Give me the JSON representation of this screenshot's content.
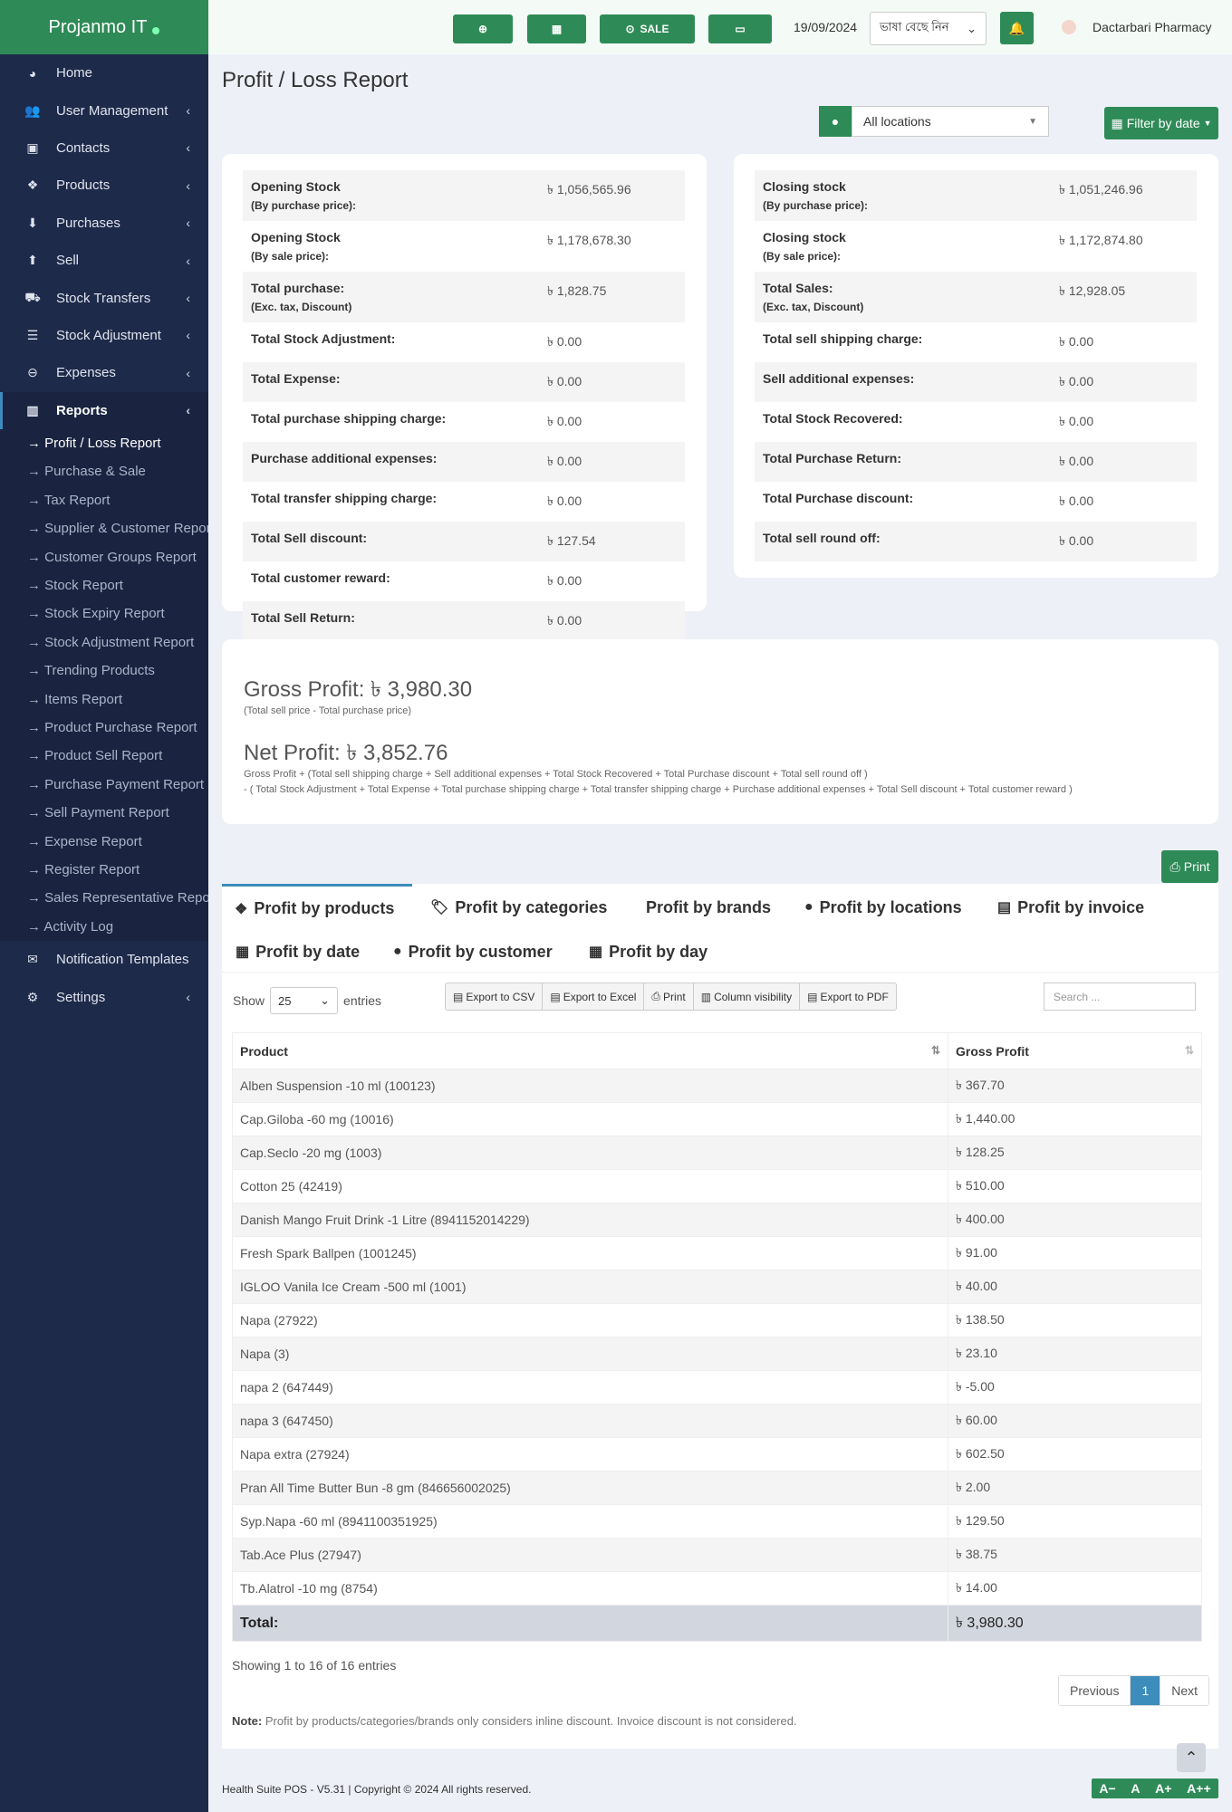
{
  "brand": {
    "name": "Projanmo IT"
  },
  "sidebar": {
    "items": [
      {
        "label": "Home",
        "icon": "dashboard-icon"
      },
      {
        "label": "User Management",
        "icon": "users-icon"
      },
      {
        "label": "Contacts",
        "icon": "address-book-icon"
      },
      {
        "label": "Products",
        "icon": "cubes-icon"
      },
      {
        "label": "Purchases",
        "icon": "arrow-circle-down-icon"
      },
      {
        "label": "Sell",
        "icon": "arrow-circle-up-icon"
      },
      {
        "label": "Stock Transfers",
        "icon": "truck-icon"
      },
      {
        "label": "Stock Adjustment",
        "icon": "database-icon"
      },
      {
        "label": "Expenses",
        "icon": "minus-circle-icon"
      },
      {
        "label": "Reports",
        "icon": "bar-chart-icon"
      }
    ],
    "reports_sub": [
      "→ Profit / Loss Report",
      "→ Purchase & Sale",
      "→ Tax Report",
      "→ Supplier & Customer Report",
      "→ Customer Groups Report",
      "→ Stock Report",
      "→ Stock Expiry Report",
      "→ Stock Adjustment Report",
      "→ Trending Products",
      "→ Items Report",
      "→ Product Purchase Report",
      "→ Product Sell Report",
      "→ Purchase Payment Report",
      "→ Sell Payment Report",
      "→ Expense Report",
      "→ Register Report",
      "→ Sales Representative Report",
      "→ Activity Log"
    ],
    "bottom_items": [
      {
        "label": "Notification Templates",
        "icon": "envelope-icon"
      },
      {
        "label": "Settings",
        "icon": "cog-icon"
      }
    ]
  },
  "topbar": {
    "sale_label": "SALE",
    "date": "19/09/2024",
    "language_label": "ভাষা বেছে নিন",
    "user": "Dactarbari Pharmacy"
  },
  "page": {
    "title": "Profit / Loss Report"
  },
  "filters": {
    "location": "All locations",
    "filter_label": "Filter by date"
  },
  "left_stats": [
    {
      "label": "Opening Stock",
      "sub": "(By purchase price):",
      "value": "৳ 1,056,565.96"
    },
    {
      "label": "Opening Stock",
      "sub": "(By sale price):",
      "value": "৳ 1,178,678.30"
    },
    {
      "label": "Total purchase:",
      "sub": "(Exc. tax, Discount)",
      "value": "৳ 1,828.75"
    },
    {
      "label": "Total Stock Adjustment:",
      "sub": "",
      "value": "৳ 0.00"
    },
    {
      "label": "Total Expense:",
      "sub": "",
      "value": "৳ 0.00"
    },
    {
      "label": "Total purchase shipping charge:",
      "sub": "",
      "value": "৳ 0.00"
    },
    {
      "label": "Purchase additional expenses:",
      "sub": "",
      "value": "৳ 0.00"
    },
    {
      "label": "Total transfer shipping charge:",
      "sub": "",
      "value": "৳ 0.00"
    },
    {
      "label": "Total Sell discount:",
      "sub": "",
      "value": "৳ 127.54"
    },
    {
      "label": "Total customer reward:",
      "sub": "",
      "value": "৳ 0.00"
    },
    {
      "label": "Total Sell Return:",
      "sub": "",
      "value": "৳ 0.00"
    }
  ],
  "right_stats": [
    {
      "label": "Closing stock",
      "sub": "(By purchase price):",
      "value": "৳ 1,051,246.96"
    },
    {
      "label": "Closing stock",
      "sub": "(By sale price):",
      "value": "৳ 1,172,874.80"
    },
    {
      "label": "Total Sales:",
      "sub": "(Exc. tax, Discount)",
      "value": "৳ 12,928.05"
    },
    {
      "label": "Total sell shipping charge:",
      "sub": "",
      "value": "৳ 0.00"
    },
    {
      "label": "Sell additional expenses:",
      "sub": "",
      "value": "৳ 0.00"
    },
    {
      "label": "Total Stock Recovered:",
      "sub": "",
      "value": "৳ 0.00"
    },
    {
      "label": "Total Purchase Return:",
      "sub": "",
      "value": "৳ 0.00"
    },
    {
      "label": "Total Purchase discount:",
      "sub": "",
      "value": "৳ 0.00"
    },
    {
      "label": "Total sell round off:",
      "sub": "",
      "value": "৳ 0.00"
    }
  ],
  "profit": {
    "gross_label": "Gross Profit: ৳ 3,980.30",
    "gross_note": "(Total sell price - Total purchase price)",
    "net_label": "Net Profit: ৳ 3,852.76",
    "net_note_1": "Gross Profit + (Total sell shipping charge + Sell additional expenses + Total Stock Recovered + Total Purchase discount + Total sell round off )",
    "net_note_2": "- ( Total Stock Adjustment + Total Expense + Total purchase shipping charge + Total transfer shipping charge + Purchase additional expenses + Total Sell discount + Total customer reward )"
  },
  "print_label": "Print",
  "tabs": [
    {
      "label": "Profit by products",
      "icon": "cubes-icon"
    },
    {
      "label": "Profit by categories",
      "icon": "tags-icon"
    },
    {
      "label": "Profit by brands",
      "icon": ""
    },
    {
      "label": "Profit by locations",
      "icon": "map-marker-icon"
    },
    {
      "label": "Profit by invoice",
      "icon": "file-icon"
    },
    {
      "label": "Profit by date",
      "icon": "calendar-icon"
    },
    {
      "label": "Profit by customer",
      "icon": "user-icon"
    },
    {
      "label": "Profit by day",
      "icon": "calendar-icon"
    }
  ],
  "table_controls": {
    "show": "Show",
    "entries_value": "25",
    "entries": "entries",
    "export_csv": "Export to CSV",
    "export_excel": "Export to Excel",
    "print": "Print",
    "column_visibility": "Column visibility",
    "export_pdf": "Export to PDF",
    "search_placeholder": "Search ..."
  },
  "table": {
    "headers": [
      "Product",
      "Gross Profit"
    ],
    "rows": [
      [
        "Alben Suspension -10 ml (100123)",
        "৳ 367.70"
      ],
      [
        "Cap.Giloba -60 mg (10016)",
        "৳ 1,440.00"
      ],
      [
        "Cap.Seclo -20 mg (1003)",
        "৳ 128.25"
      ],
      [
        "Cotton 25 (42419)",
        "৳ 510.00"
      ],
      [
        "Danish Mango Fruit Drink -1 Litre (8941152014229)",
        "৳ 400.00"
      ],
      [
        "Fresh Spark Ballpen (1001245)",
        "৳ 91.00"
      ],
      [
        "IGLOO Vanila Ice Cream -500 ml (1001)",
        "৳ 40.00"
      ],
      [
        "Napa (27922)",
        "৳ 138.50"
      ],
      [
        "Napa (3)",
        "৳ 23.10"
      ],
      [
        "napa 2 (647449)",
        "৳ -5.00"
      ],
      [
        "napa 3 (647450)",
        "৳ 60.00"
      ],
      [
        "Napa extra (27924)",
        "৳ 602.50"
      ],
      [
        "Pran All Time Butter Bun -8 gm (846656002025)",
        "৳ 2.00"
      ],
      [
        "Syp.Napa -60 ml (8941100351925)",
        "৳ 129.50"
      ],
      [
        "Tab.Ace Plus (27947)",
        "৳ 38.75"
      ],
      [
        "Tb.Alatrol -10 mg (8754)",
        "৳ 14.00"
      ]
    ],
    "total_label": "Total:",
    "total_value": "৳ 3,980.30"
  },
  "pagination": {
    "showing": "Showing 1 to 16 of 16 entries",
    "previous": "Previous",
    "current": "1",
    "next": "Next"
  },
  "note": {
    "label": "Note:",
    "text": " Profit by products/categories/brands only considers inline discount. Invoice discount is not considered."
  },
  "footer": {
    "text": "Health Suite POS - V5.31 | Copyright © 2024 All rights reserved."
  },
  "font_controls": [
    "A−",
    "A",
    "A+",
    "A++"
  ]
}
